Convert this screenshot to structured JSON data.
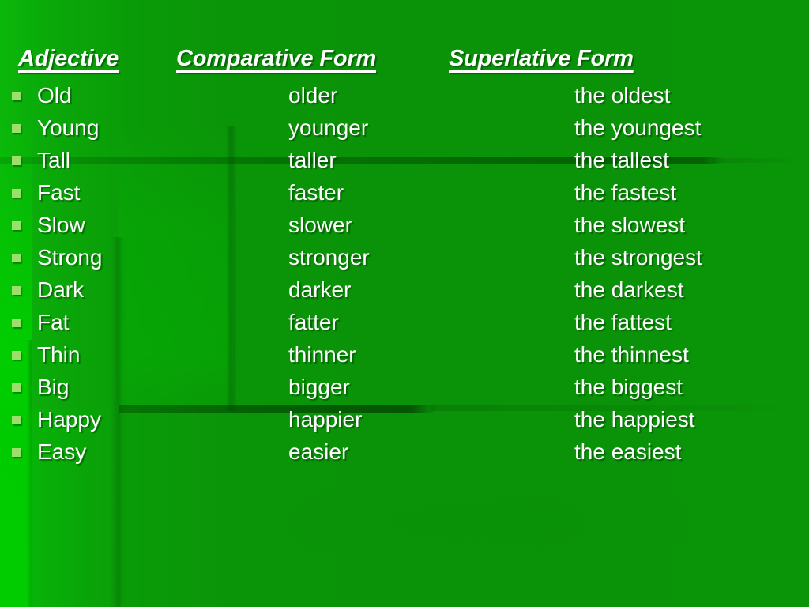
{
  "slide": {
    "background_color": "#0a9408",
    "accent_bright_color": "#00c800",
    "bullet_color": "#9ae06a",
    "text_color": "#ffffff",
    "headers": {
      "adjective": "Adjective",
      "comparative": "Comparative Form",
      "superlative": "Superlative Form"
    },
    "rows": [
      {
        "bullet": "square-bullet-icon",
        "adjective": "Old",
        "comparative": "older",
        "superlative": "the oldest"
      },
      {
        "bullet": "square-bullet-icon",
        "adjective": "Young",
        "comparative": "younger",
        "superlative": "the youngest"
      },
      {
        "bullet": "square-bullet-icon",
        "adjective": "Tall",
        "comparative": "taller",
        "superlative": "the tallest"
      },
      {
        "bullet": "square-bullet-icon",
        "adjective": "Fast",
        "comparative": "faster",
        "superlative": "the fastest"
      },
      {
        "bullet": "square-bullet-icon",
        "adjective": "Slow",
        "comparative": "slower",
        "superlative": "the slowest"
      },
      {
        "bullet": "square-bullet-icon",
        "adjective": "Strong",
        "comparative": "stronger",
        "superlative": "the strongest"
      },
      {
        "bullet": "square-bullet-icon",
        "adjective": "Dark",
        "comparative": "darker",
        "superlative": "the darkest"
      },
      {
        "bullet": "square-bullet-icon",
        "adjective": "Fat",
        "comparative": "fatter",
        "superlative": "the fattest"
      },
      {
        "bullet": "square-bullet-icon",
        "adjective": "Thin",
        "comparative": "thinner",
        "superlative": "the thinnest"
      },
      {
        "bullet": "square-bullet-icon",
        "adjective": "Big",
        "comparative": "bigger",
        "superlative": "the biggest"
      },
      {
        "bullet": "square-bullet-icon",
        "adjective": "Happy",
        "comparative": "happier",
        "superlative": "the happiest"
      },
      {
        "bullet": "square-bullet-icon",
        "adjective": "Easy",
        "comparative": "easier",
        "superlative": "the easiest"
      }
    ]
  }
}
